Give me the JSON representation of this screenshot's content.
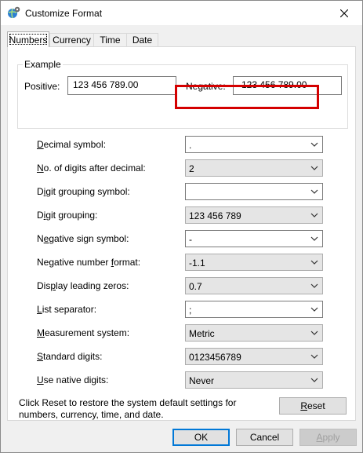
{
  "window": {
    "title": "Customize Format"
  },
  "tabs": [
    {
      "label": "Numbers",
      "active": true
    },
    {
      "label": "Currency"
    },
    {
      "label": "Time"
    },
    {
      "label": "Date"
    }
  ],
  "example": {
    "legend": "Example",
    "positive_label": "Positive:",
    "positive_value": "123 456 789.00",
    "negative_label": "Negative:",
    "negative_value": "-123 456 789.00"
  },
  "settings": {
    "decimal_symbol": {
      "pre": "",
      "key": "D",
      "post": "ecimal symbol:",
      "value": "."
    },
    "digits_after_decimal": {
      "pre": "",
      "key": "N",
      "post": "o. of digits after decimal:",
      "value": "2"
    },
    "digit_grouping_symbol": {
      "pre": "D",
      "key": "i",
      "post": "git grouping symbol:",
      "value": " "
    },
    "digit_grouping": {
      "pre": "D",
      "key": "i",
      "post": "git grouping:",
      "value": "123 456 789"
    },
    "negative_sign_symbol": {
      "pre": "N",
      "key": "e",
      "post": "gative sign symbol:",
      "value": "-"
    },
    "negative_number_format": {
      "pre": "Negative number ",
      "key": "f",
      "post": "ormat:",
      "value": "-1.1"
    },
    "display_leading_zeros": {
      "pre": "Dis",
      "key": "p",
      "post": "lay leading zeros:",
      "value": "0.7"
    },
    "list_separator": {
      "pre": "",
      "key": "L",
      "post": "ist separator:",
      "value": ";"
    },
    "measurement_system": {
      "pre": "",
      "key": "M",
      "post": "easurement system:",
      "value": "Metric"
    },
    "standard_digits": {
      "pre": "",
      "key": "S",
      "post": "tandard digits:",
      "value": "0123456789"
    },
    "use_native_digits": {
      "pre": "",
      "key": "U",
      "post": "se native digits:",
      "value": "Never"
    }
  },
  "reset_info": "Click Reset to restore the system default settings for numbers, currency, time, and date.",
  "buttons": {
    "reset_key": "R",
    "reset_rest": "eset",
    "ok": "OK",
    "cancel": "Cancel",
    "apply_key": "A",
    "apply_rest": "pply"
  },
  "colors": {
    "highlight": "#d40000",
    "accent": "#0078d7"
  },
  "icons": {
    "title_icon": "globe-gear-icon",
    "close": "close-icon",
    "dropdown": "chevron-down-icon"
  }
}
